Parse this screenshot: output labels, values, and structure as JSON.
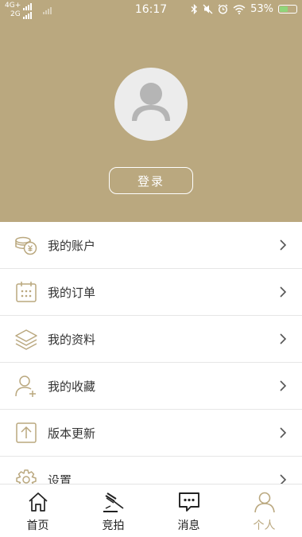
{
  "status_bar": {
    "network_top": "4G+",
    "network_bottom": "2G",
    "time": "16:17",
    "battery": "53%"
  },
  "profile": {
    "login_label": "登录"
  },
  "menu": {
    "items": [
      {
        "label": "我的账户",
        "icon": "coins-icon"
      },
      {
        "label": "我的订单",
        "icon": "calendar-icon"
      },
      {
        "label": "我的资料",
        "icon": "layers-icon"
      },
      {
        "label": "我的收藏",
        "icon": "user-add-icon"
      },
      {
        "label": "版本更新",
        "icon": "upload-icon"
      },
      {
        "label": "设置",
        "icon": "gear-icon"
      }
    ]
  },
  "tabbar": {
    "tabs": [
      {
        "label": "首页",
        "icon": "home-icon"
      },
      {
        "label": "竞拍",
        "icon": "gavel-icon"
      },
      {
        "label": "消息",
        "icon": "message-icon"
      },
      {
        "label": "个人",
        "icon": "person-icon",
        "active": true
      }
    ]
  },
  "colors": {
    "accent": "#baa87f",
    "avatar_bg": "#ececec",
    "battery_fill": "#8fd57a"
  }
}
